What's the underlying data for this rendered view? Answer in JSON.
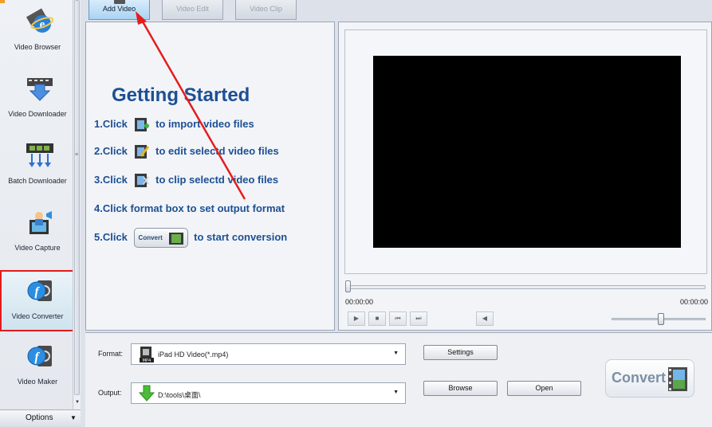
{
  "sidebar": {
    "items": [
      {
        "label": "Video Browser",
        "icon": "video-browser-icon"
      },
      {
        "label": "Video Downloader",
        "icon": "video-downloader-icon"
      },
      {
        "label": "Batch Downloader",
        "icon": "batch-downloader-icon"
      },
      {
        "label": "Video Capture",
        "icon": "video-capture-icon"
      },
      {
        "label": "Video Converter",
        "icon": "video-converter-icon"
      },
      {
        "label": "Video Maker",
        "icon": "video-maker-icon"
      }
    ],
    "active_item": "Video Converter",
    "options_label": "Options"
  },
  "tabs": [
    {
      "label": "Add Video",
      "active": true
    },
    {
      "label": "Video Edit",
      "active": false
    },
    {
      "label": "Video Clip",
      "active": false
    }
  ],
  "getting_started": {
    "title": "Getting Started",
    "steps": [
      {
        "number": "1.Click",
        "text": "to import video files"
      },
      {
        "number": "2.Click",
        "text": "to edit selectd video files"
      },
      {
        "number": "3.Click",
        "text": "to clip selectd video files"
      },
      {
        "text": "4.Click format box to set output format"
      },
      {
        "number": "5.Click",
        "text": "to start conversion"
      }
    ],
    "convert_chip_label": "Convert"
  },
  "preview": {
    "time_current": "00:00:00",
    "time_total": "00:00:00",
    "seek_fraction": 0,
    "volume_fraction": 0.53
  },
  "bottom": {
    "format_label": "Format:",
    "format_value": "iPad HD Video(*.mp4)",
    "output_label": "Output:",
    "output_value": "D:\\tools\\桌面\\",
    "settings_button": "Settings",
    "browse_button": "Browse",
    "open_button": "Open",
    "convert_button": "Convert"
  },
  "colors": {
    "accent_blue": "#1e4f93",
    "highlight_red": "#e21c1c",
    "active_tab": "#a9d3f3"
  }
}
